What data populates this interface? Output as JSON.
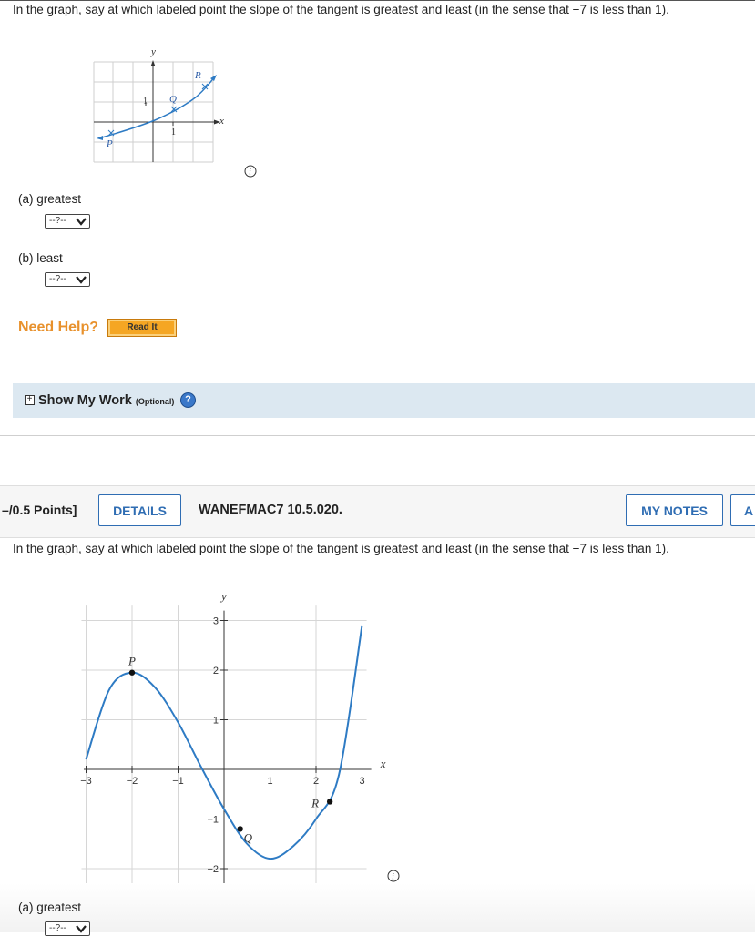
{
  "q1": {
    "question": "In the graph, say at which labeled point the slope of the tangent is greatest and least (in the sense that −7 is less than 1).",
    "graph": {
      "y_label": "y",
      "x_label": "x",
      "tick_y": "1",
      "tick_x": "1",
      "points": [
        "P",
        "Q",
        "R"
      ]
    },
    "part_a": {
      "label": "(a)  greatest",
      "value": "--?--"
    },
    "part_b": {
      "label": "(b)  least",
      "value": "--?--"
    },
    "need_help": "Need Help?",
    "read_it": "Read It",
    "show_work": "Show My Work",
    "show_work_optional": "(Optional)",
    "help_glyph": "?"
  },
  "q2": {
    "points": "–/0.5 Points]",
    "details_button": "DETAILS",
    "code": "WANEFMAC7 10.5.020.",
    "my_notes_button": "MY NOTES",
    "ask_button_partial": "A",
    "question": "In the graph, say at which labeled point the slope of the tangent is greatest and least (in the sense that −7 is less than 1).",
    "part_a": {
      "label": "(a)  greatest",
      "value": "--?--"
    }
  },
  "chart_data": {
    "type": "line",
    "x_axis_label": "x",
    "y_axis_label": "y",
    "xlim": [
      -3.1,
      3.1
    ],
    "ylim": [
      -2.3,
      3.3
    ],
    "x_ticks": [
      "−3",
      "−2",
      "−1",
      "1",
      "2",
      "3"
    ],
    "y_ticks": [
      "3",
      "2",
      "1",
      "−1",
      "−2"
    ],
    "grid": true,
    "curve": {
      "x": [
        -3.0,
        -2.5,
        -2.0,
        -1.5,
        -1.0,
        -0.5,
        0.0,
        0.5,
        1.0,
        1.5,
        2.0,
        2.5,
        3.0
      ],
      "y": [
        0.2,
        1.6,
        1.95,
        1.65,
        0.95,
        0.05,
        -0.8,
        -1.5,
        -1.8,
        -1.55,
        -1.0,
        -0.1,
        2.9
      ]
    },
    "labeled_points": [
      {
        "label": "P",
        "x": -2.0,
        "y": 1.95
      },
      {
        "label": "Q",
        "x": 0.35,
        "y": -1.2
      },
      {
        "label": "R",
        "x": 2.3,
        "y": -0.65
      }
    ]
  }
}
